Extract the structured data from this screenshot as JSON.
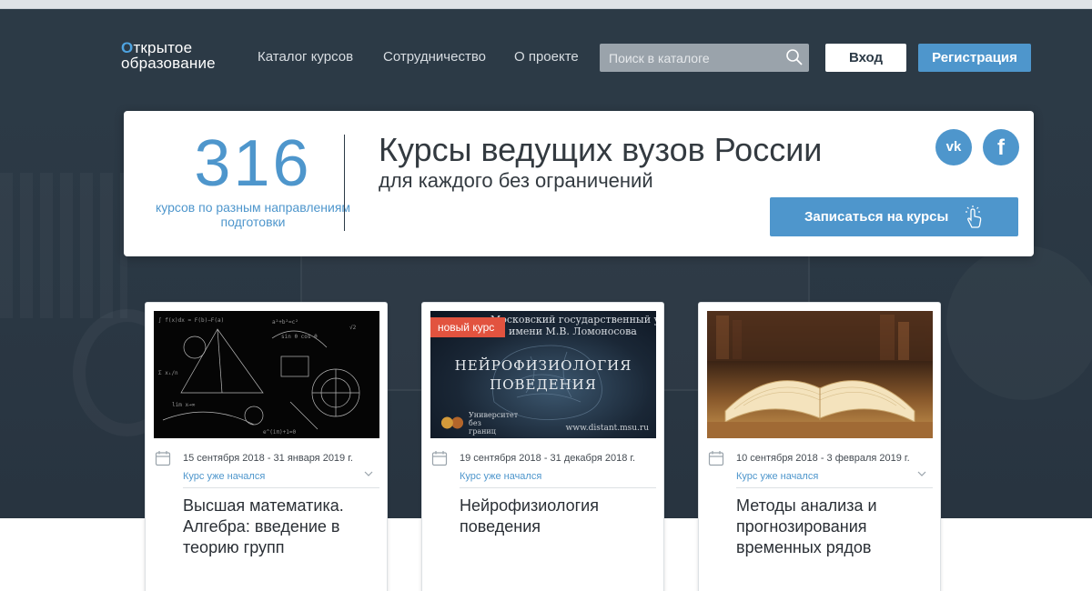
{
  "header": {
    "logo_line1": "ткрытое",
    "logo_line2": "образование",
    "logo_letter": "О",
    "nav": [
      "Каталог курсов",
      "Сотрудничество",
      "О проекте"
    ],
    "search_placeholder": "Поиск в каталоге",
    "login_label": "Вход",
    "register_label": "Регистрация"
  },
  "banner": {
    "count": "316",
    "count_sub": "курсов по разным направлениям подготовки",
    "title": "Курсы ведущих вузов России",
    "subtitle": "для каждого без ограничений",
    "social": [
      "vk",
      "f"
    ],
    "cta_label": "Записаться на курсы"
  },
  "courses": [
    {
      "date": "15 сентября 2018 - 31 января 2019 г.",
      "status": "Курс уже начался",
      "title": "Высшая математика. Алгебра: введение в теорию групп",
      "image_icon": "math-formulas-image"
    },
    {
      "badge": "новый курс",
      "image_top1": "Московский государственный университет",
      "image_top2": "имени М.В. Ломоносова",
      "image_title": "НЕЙРОФИЗИОЛОГИЯ ПОВЕДЕНИЯ",
      "image_uni": "Университет без границ",
      "image_site": "www.distant.msu.ru",
      "date": "19 сентября 2018 - 31 декабря 2018 г.",
      "status": "Курс уже начался",
      "title": "Нейрофизиология поведения",
      "image_icon": "brain-image"
    },
    {
      "date": "10 сентября 2018 - 3 февраля 2019 г.",
      "status": "Курс уже начался",
      "title": "Методы анализа и прогнозирования временных рядов",
      "image_icon": "open-book-image"
    }
  ],
  "colors": {
    "accent": "#4e96cc",
    "header_bg": "#2c3a46",
    "badge": "#e2533f"
  }
}
